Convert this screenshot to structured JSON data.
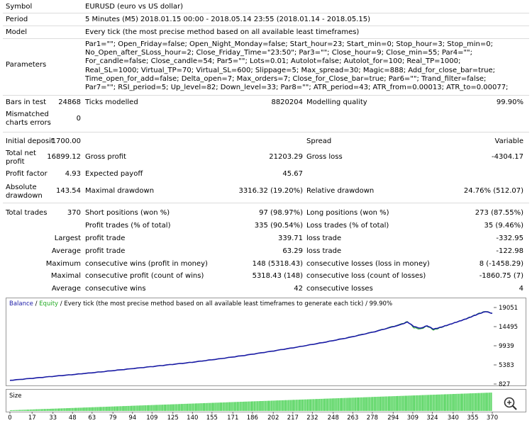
{
  "report": {
    "symbol": {
      "label": "Symbol",
      "value": "EURUSD (euro vs US dollar)"
    },
    "period": {
      "label": "Period",
      "value": "5 Minutes (M5) 2018.01.15 00:00 - 2018.05.14 23:55 (2018.01.14 - 2018.05.15)"
    },
    "model": {
      "label": "Model",
      "value": "Every tick (the most precise method based on all available least timeframes)"
    },
    "parameters": {
      "label": "Parameters",
      "value": "Par1=\"\"; Open_Friday=false; Open_Night_Monday=false; Start_hour=23; Start_min=0; Stop_hour=3; Stop_min=0; No_Open_after_SLoss_hour=2; Close_Friday_Time=\"23:50\"; Par3=\"\"; Close_hour=9; Close_min=55; Par4=\"\"; For_candle=false; Close_candle=54; Par5=\"\"; Lots=0.01; Autolot=false; Autolot_for=100; Real_TP=1000; Real_SL=1000; Virtual_TP=70; Virtual_SL=600; Slippage=5; Max_spread=30; Magic=888; Add_for_close_bar=true; Time_open_for_add=false; Delta_open=7; Max_orders=7; Close_for_Close_bar=true; Par6=\"\"; Trand_filter=false; Par7=\"\"; RSI_period=5; Up_level=82; Down_level=33; Par8=\"\"; ATR_period=43; ATR_from=0.00013; ATR_to=0.00077;"
    },
    "bars_in_test": {
      "label": "Bars in test",
      "value": "24868"
    },
    "ticks_modelled": {
      "label": "Ticks modelled",
      "value": "8820204"
    },
    "modelling_quality": {
      "label": "Modelling quality",
      "value": "99.90%"
    },
    "mismatched": {
      "label1": "Mismatched",
      "label2": "charts errors",
      "value": "0"
    },
    "initial_deposit": {
      "label": "Initial deposit",
      "value": "1700.00"
    },
    "spread": {
      "label": "Spread",
      "value": "Variable"
    },
    "total_net_profit": {
      "label1": "Total net",
      "label2": "profit",
      "value": "16899.12"
    },
    "gross_profit": {
      "label": "Gross profit",
      "value": "21203.29"
    },
    "gross_loss": {
      "label": "Gross loss",
      "value": "-4304.17"
    },
    "profit_factor": {
      "label": "Profit factor",
      "value": "4.93"
    },
    "expected_payoff": {
      "label": "Expected payoff",
      "value": "45.67"
    },
    "absolute_drawdown": {
      "label1": "Absolute",
      "label2": "drawdown",
      "value": "143.54"
    },
    "maximal_drawdown": {
      "label": "Maximal drawdown",
      "value": "3316.32 (19.20%)"
    },
    "relative_drawdown": {
      "label": "Relative drawdown",
      "value": "24.76% (512.07)"
    },
    "total_trades": {
      "label": "Total trades",
      "value": "370"
    },
    "short_positions": {
      "label": "Short positions (won %)",
      "value": "97 (98.97%)"
    },
    "long_positions": {
      "label": "Long positions (won %)",
      "value": "273 (87.55%)"
    },
    "profit_trades": {
      "label": "Profit trades (% of total)",
      "value": "335 (90.54%)"
    },
    "loss_trades": {
      "label": "Loss trades (% of total)",
      "value": "35 (9.46%)"
    },
    "largest_label": "Largest",
    "largest_profit": {
      "label": "profit trade",
      "value": "339.71"
    },
    "largest_loss": {
      "label": "loss trade",
      "value": "-332.95"
    },
    "average_label": "Average",
    "average_profit": {
      "label": "profit trade",
      "value": "63.29"
    },
    "average_loss": {
      "label": "loss trade",
      "value": "-122.98"
    },
    "maximum_label": "Maximum",
    "max_consec_wins": {
      "label": "consecutive wins (profit in money)",
      "value": "148 (5318.43)"
    },
    "max_consec_losses": {
      "label": "consecutive losses (loss in money)",
      "value": "8 (-1458.29)"
    },
    "maximal_label": "Maximal",
    "maximal_consec_profit": {
      "label": "consecutive profit (count of wins)",
      "value": "5318.43 (148)"
    },
    "maximal_consec_loss": {
      "label": "consecutive loss (count of losses)",
      "value": "-1860.75 (7)"
    },
    "average2_label": "Average",
    "avg_consec_wins": {
      "label": "consecutive wins",
      "value": "42"
    },
    "avg_consec_losses": {
      "label": "consecutive losses",
      "value": "4"
    }
  },
  "chart_legend": {
    "balance": "Balance",
    "slash": " / ",
    "equity": "Equity",
    "rest": " / Every tick (the most precise method based on all available least timeframes to generate each tick) / 99.90%"
  },
  "colors": {
    "balance": "#1a1aa6",
    "equity": "#22aa22",
    "legend_blue": "#1a1aa6",
    "legend_green": "#22aa22",
    "size_bars": "#3fcf4a"
  },
  "zoom_icon": "magnifier-plus-icon",
  "chart_data": {
    "type": "line",
    "title": "",
    "x_ticks": [
      "0",
      "17",
      "33",
      "48",
      "63",
      "79",
      "94",
      "109",
      "125",
      "140",
      "155",
      "171",
      "186",
      "202",
      "217",
      "232",
      "248",
      "263",
      "278",
      "294",
      "309",
      "324",
      "340",
      "355",
      "370"
    ],
    "y_ticks": [
      "19051",
      "14495",
      "9939",
      "5383",
      "827"
    ],
    "ylim": [
      827,
      19051
    ],
    "xlim": [
      0,
      370
    ],
    "series": [
      {
        "name": "Balance",
        "x": [
          0,
          20,
          40,
          60,
          80,
          100,
          120,
          140,
          160,
          180,
          200,
          220,
          240,
          260,
          280,
          300,
          305,
          310,
          315,
          320,
          325,
          330,
          340,
          350,
          360,
          365,
          370
        ],
        "values": [
          1700,
          2280,
          2850,
          3420,
          4050,
          4700,
          5350,
          6020,
          6800,
          7650,
          8600,
          9600,
          10700,
          11900,
          13300,
          15000,
          15600,
          14500,
          14100,
          14700,
          13900,
          14300,
          15300,
          16350,
          17600,
          18100,
          17650
        ]
      },
      {
        "name": "Equity",
        "x": [
          0,
          20,
          40,
          60,
          80,
          100,
          120,
          140,
          160,
          180,
          200,
          220,
          240,
          260,
          280,
          300,
          305,
          310,
          315,
          320,
          325,
          330,
          340,
          350,
          360,
          365,
          370
        ],
        "values": [
          1700,
          2280,
          2850,
          3420,
          4050,
          4700,
          5350,
          6020,
          6800,
          7650,
          8600,
          9600,
          10700,
          11950,
          13350,
          15100,
          15700,
          14200,
          13900,
          14600,
          13700,
          14200,
          15300,
          16400,
          17700,
          18150,
          17700
        ]
      }
    ],
    "size_bars": {
      "name": "Size"
    }
  }
}
